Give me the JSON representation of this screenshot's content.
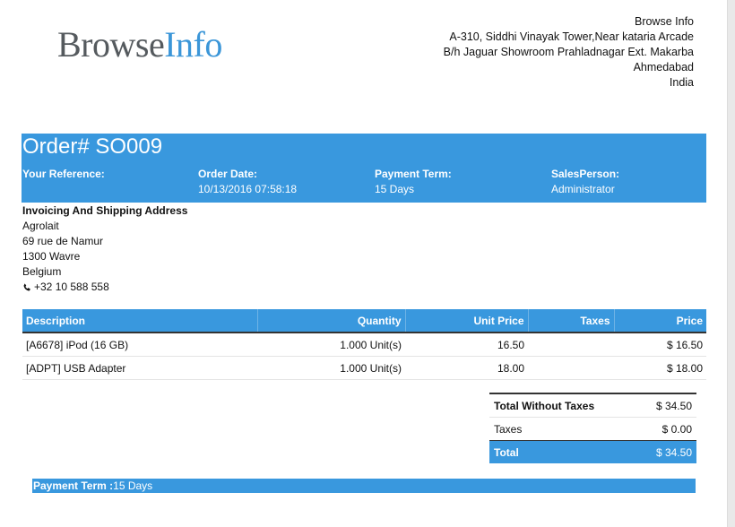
{
  "logo": {
    "part1": "Browse",
    "part2": "Info"
  },
  "company": {
    "lines": [
      "Browse Info",
      "A-310, Siddhi Vinayak Tower,Near kataria Arcade",
      "B/h Jaguar Showroom Prahladnagar Ext. Makarba",
      "Ahmedabad",
      "India"
    ]
  },
  "order": {
    "title": "Order# SO009",
    "fields": [
      {
        "label": "Your Reference:",
        "value": ""
      },
      {
        "label": "Order Date:",
        "value": "10/13/2016 07:58:18"
      },
      {
        "label": "Payment Term:",
        "value": "15 Days"
      },
      {
        "label": "SalesPerson:",
        "value": "Administrator"
      }
    ]
  },
  "address": {
    "heading": "Invoicing And Shipping Address",
    "lines": [
      "Agrolait",
      "69 rue de Namur",
      "1300 Wavre",
      "Belgium"
    ],
    "phone_icon": "phone-icon",
    "phone": "+32 10 588 558"
  },
  "table": {
    "headers": [
      "Description",
      "Quantity",
      "Unit Price",
      "Taxes",
      "Price"
    ],
    "rows": [
      {
        "description": "[A6678] iPod (16 GB)",
        "quantity": "1.000 Unit(s)",
        "unit_price": "16.50",
        "taxes": "",
        "price": "$ 16.50"
      },
      {
        "description": "[ADPT] USB Adapter",
        "quantity": "1.000 Unit(s)",
        "unit_price": "18.00",
        "taxes": "",
        "price": "$ 18.00"
      }
    ]
  },
  "totals": {
    "untaxed_label": "Total Without Taxes",
    "untaxed": "$ 34.50",
    "taxes_label": "Taxes",
    "taxes": "$ 0.00",
    "total_label": "Total",
    "total": "$ 34.50"
  },
  "payment": {
    "label": "Payment Term :",
    "value": "15 Days"
  },
  "colors": {
    "accent": "#3998de",
    "logo_dark": "#555a5e",
    "logo_blue": "#3b96d8"
  }
}
